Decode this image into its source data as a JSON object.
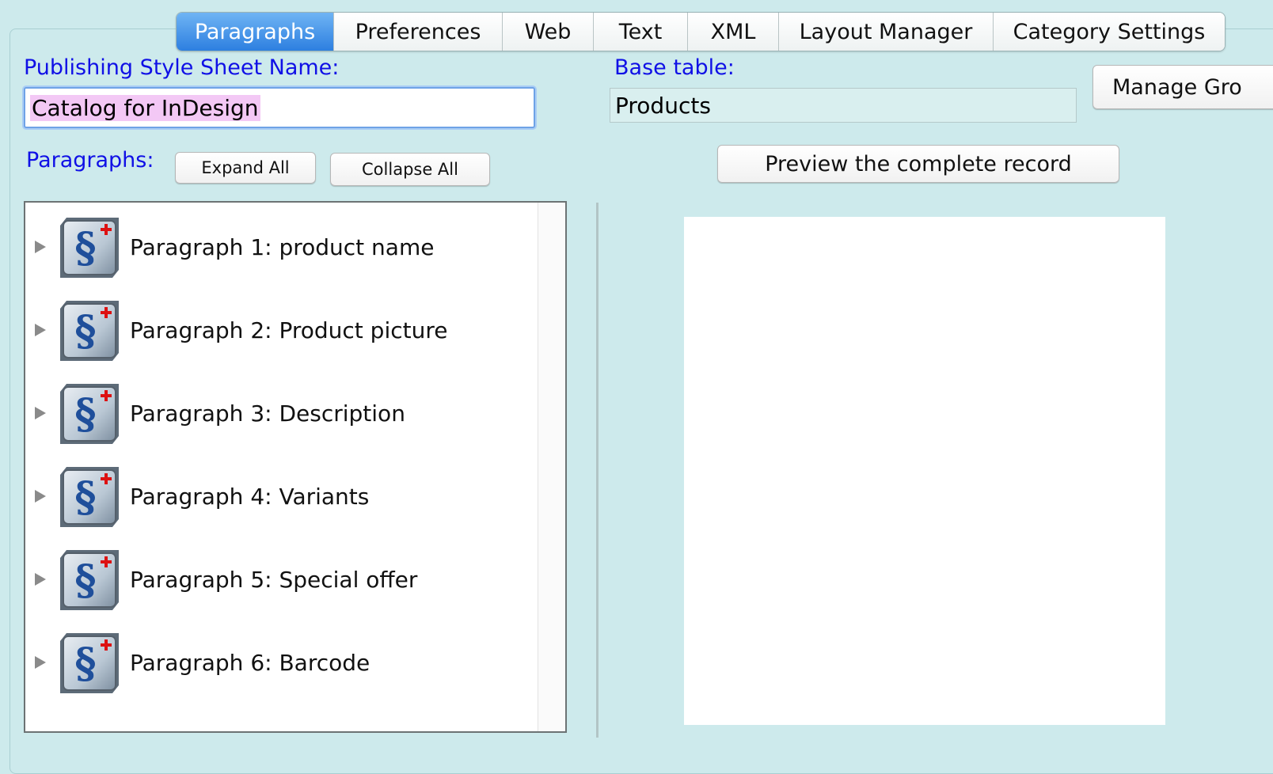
{
  "tabs": [
    "Paragraphs",
    "Preferences",
    "Web",
    "Text",
    "XML",
    "Layout Manager",
    "Category Settings"
  ],
  "style_sheet": {
    "label": "Publishing Style Sheet Name:",
    "value": "Catalog for InDesign"
  },
  "base_table": {
    "label": "Base table:",
    "value": "Products"
  },
  "manage_button": "Manage Gro",
  "paragraphs": {
    "label": "Paragraphs:",
    "expand_all": "Expand All",
    "collapse_all": "Collapse All",
    "items": [
      "Paragraph 1: product name",
      "Paragraph 2: Product picture",
      "Paragraph 3: Description",
      "Paragraph 4: Variants",
      "Paragraph 5: Special offer",
      "Paragraph 6: Barcode"
    ]
  },
  "preview_button": "Preview the complete record",
  "colors": {
    "background": "#cdeaec",
    "label_blue": "#1010e6",
    "tab_active": "#2d7fe0",
    "selection_pink": "#f3c8f5"
  },
  "icons": {
    "paragraph_icon": "paragraph-section-plus-icon",
    "expand": "disclosure-triangle-icon"
  }
}
